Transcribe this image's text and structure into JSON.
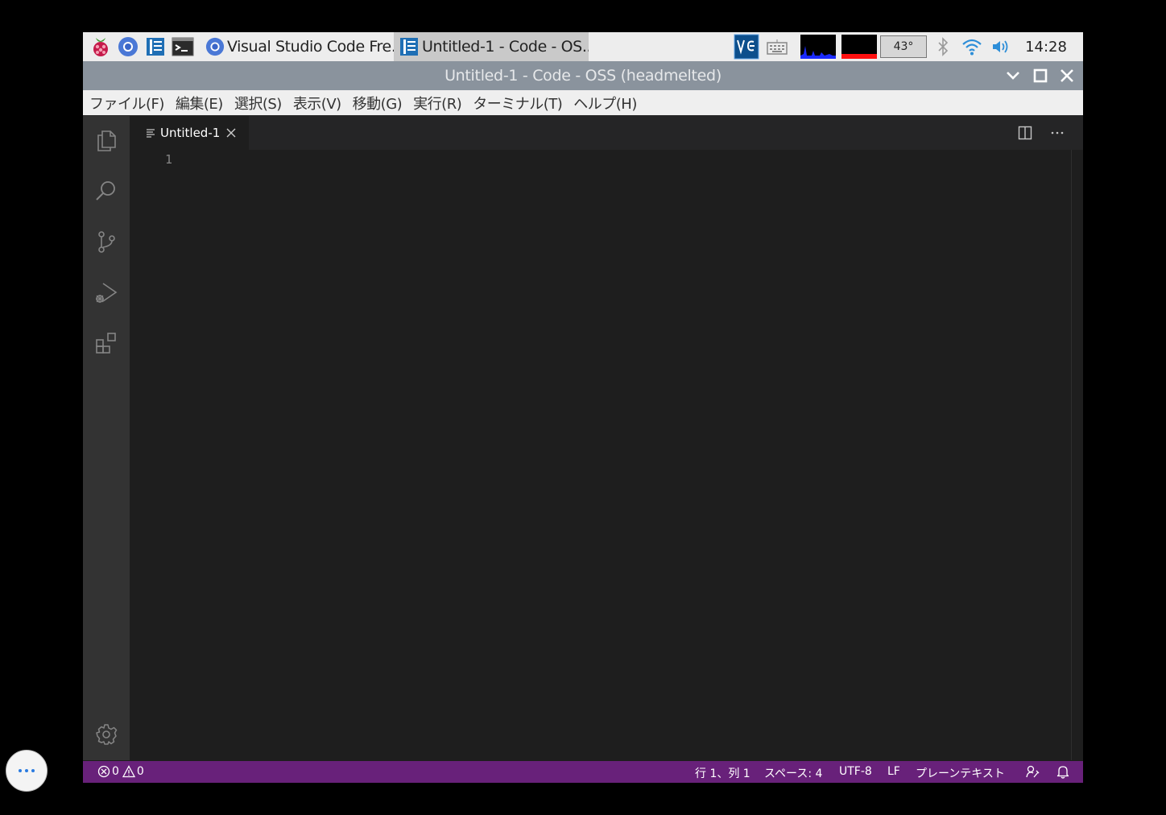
{
  "taskbar": {
    "tasks": [
      {
        "label": "Visual Studio Code Fre..."
      },
      {
        "label": "Untitled-1 - Code - OS..."
      }
    ],
    "temperature": "43°",
    "clock": "14:28"
  },
  "window": {
    "title": "Untitled-1 - Code - OSS (headmelted)"
  },
  "menubar": {
    "items": [
      "ファイル(F)",
      "編集(E)",
      "選択(S)",
      "表示(V)",
      "移動(G)",
      "実行(R)",
      "ターミナル(T)",
      "ヘルプ(H)"
    ]
  },
  "editor": {
    "tab": {
      "label": "Untitled-1"
    },
    "line_numbers": [
      "1"
    ]
  },
  "statusbar": {
    "errors": "0",
    "warnings": "0",
    "position": "行 1、列 1",
    "indent": "スペース: 4",
    "encoding": "UTF-8",
    "eol": "LF",
    "language": "プレーンテキスト"
  },
  "colors": {
    "statusbar": "#68217a",
    "editor_bg": "#1e1e1e",
    "activitybar": "#333333",
    "titlebar": "#8a939d"
  }
}
